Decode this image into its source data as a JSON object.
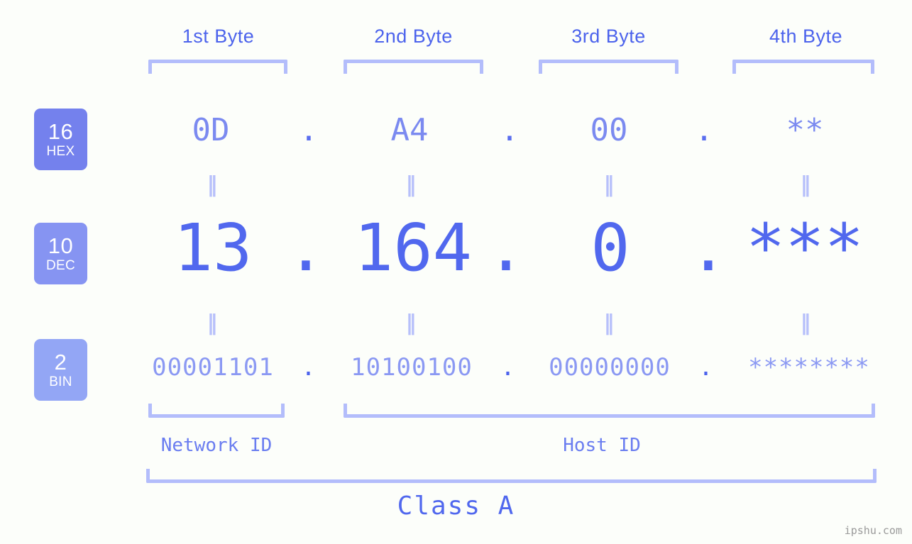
{
  "meta": {
    "background_color": "#fcfefa",
    "accent_color": "#5168ee",
    "bracket_color": "#b3bdfb"
  },
  "byte_headers": [
    {
      "label": "1st Byte"
    },
    {
      "label": "2nd Byte"
    },
    {
      "label": "3rd Byte"
    },
    {
      "label": "4th Byte"
    }
  ],
  "rows": {
    "hex": {
      "badge_number": "16",
      "badge_tag": "HEX",
      "badge_color": "#7481ed",
      "values": [
        "0D",
        "A4",
        "00",
        "**"
      ],
      "separator": "."
    },
    "dec": {
      "badge_number": "10",
      "badge_tag": "DEC",
      "badge_color": "#8694f2",
      "values": [
        "13",
        "164",
        "0",
        "***"
      ],
      "separator": "."
    },
    "bin": {
      "badge_number": "2",
      "badge_tag": "BIN",
      "badge_color": "#93a6f5",
      "values": [
        "00001101",
        "10100100",
        "00000000",
        "********"
      ],
      "separator": "."
    }
  },
  "equals_glyph": "‖",
  "id_sections": [
    {
      "label": "Network ID"
    },
    {
      "label": "Host ID"
    }
  ],
  "class_label": "Class A",
  "watermark": "ipshu.com"
}
